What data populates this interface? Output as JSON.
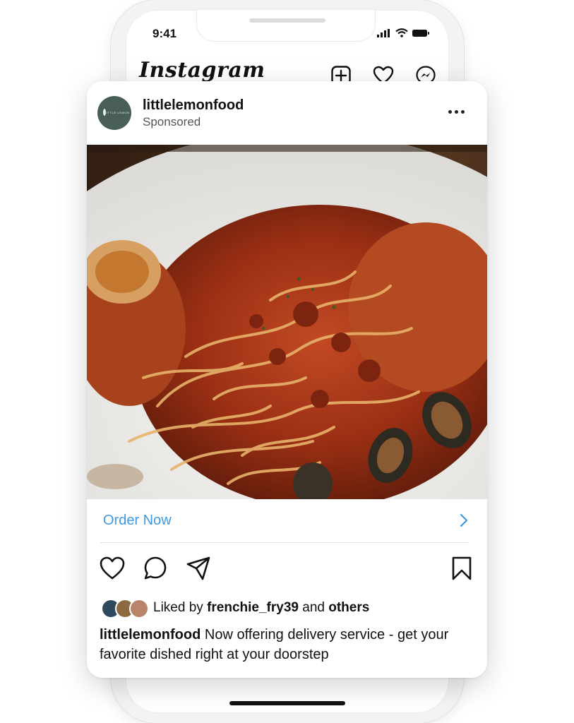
{
  "status_bar": {
    "time": "9:41"
  },
  "app": {
    "logo_text": "Instagram"
  },
  "post": {
    "username": "littlelemonfood",
    "sponsored_label": "Sponsored",
    "avatar_brand": "LITTLE LEMON",
    "cta_label": "Order Now",
    "likes": {
      "prefix": "Liked by",
      "user": "frenchie_fry39",
      "conjunction": "and",
      "others": "others"
    },
    "caption": {
      "username": "littlelemonfood",
      "text": "Now offering delivery service - get your favorite dished right at your doorstep"
    }
  },
  "icons": {
    "top_bar": [
      "add-post-icon",
      "heart-icon",
      "messenger-icon"
    ],
    "post_actions": [
      "like-icon",
      "comment-icon",
      "share-icon",
      "save-icon"
    ]
  },
  "colors": {
    "accent": "#3b9ae1",
    "avatar_bg": "#495e57"
  }
}
